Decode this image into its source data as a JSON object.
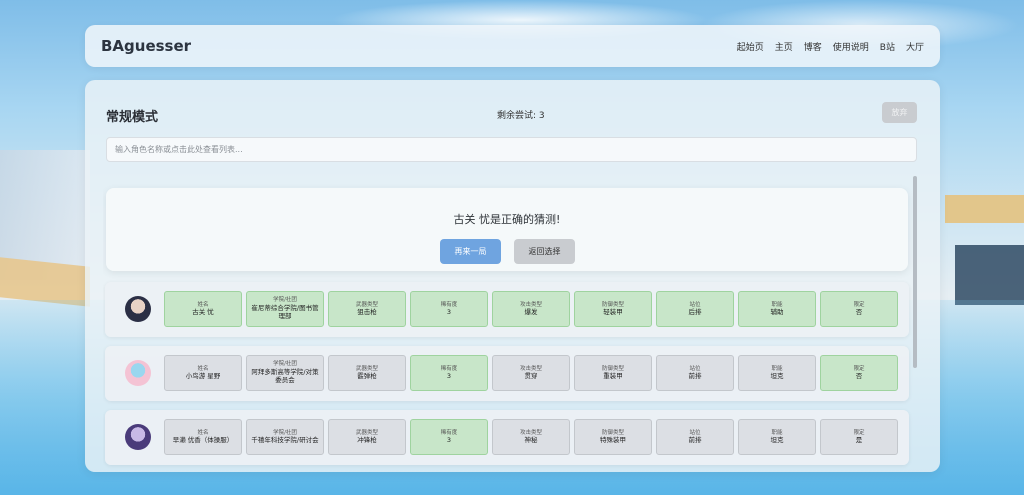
{
  "nav": {
    "brand": "BAguesser",
    "links": [
      "起始页",
      "主页",
      "博客",
      "使用说明",
      "B站",
      "大厅"
    ]
  },
  "panel": {
    "title": "常规模式",
    "attempts": "剩余尝试: 3",
    "giveup": "放弃",
    "search_placeholder": "输入角色名称或点击此处查看列表..."
  },
  "result": {
    "message": "古关 忧是正确的猜测!",
    "again": "再来一局",
    "back": "返回选择"
  },
  "columns": [
    "姓名",
    "学院/社团",
    "武器类型",
    "稀有度",
    "攻击类型",
    "防御类型",
    "站位",
    "职能",
    "限定"
  ],
  "guesses": [
    {
      "avatar_colors": [
        "#2b2f45",
        "#e8d2c6"
      ],
      "values": [
        "古关 忧",
        "崔尼蒂综合学院/图书管理部",
        "狙击枪",
        "3",
        "爆发",
        "轻装甲",
        "后排",
        "辅助",
        "否"
      ],
      "correct": [
        true,
        true,
        true,
        true,
        true,
        true,
        true,
        true,
        true
      ]
    },
    {
      "avatar_colors": [
        "#f4c3d4",
        "#9ad7ef"
      ],
      "values": [
        "小鸟游 星野",
        "阿拜多斯高等学院/对策委员会",
        "霰弹枪",
        "3",
        "贯穿",
        "重装甲",
        "前排",
        "坦克",
        "否"
      ],
      "correct": [
        false,
        false,
        false,
        true,
        false,
        false,
        false,
        false,
        true
      ]
    },
    {
      "avatar_colors": [
        "#4a3b7a",
        "#c8b9e6"
      ],
      "values": [
        "早濑 优香（体操服）",
        "千禧年科技学院/研讨会",
        "冲锋枪",
        "3",
        "神秘",
        "特殊装甲",
        "前排",
        "坦克",
        "是"
      ],
      "correct": [
        false,
        false,
        false,
        true,
        false,
        false,
        false,
        false,
        false
      ]
    }
  ]
}
